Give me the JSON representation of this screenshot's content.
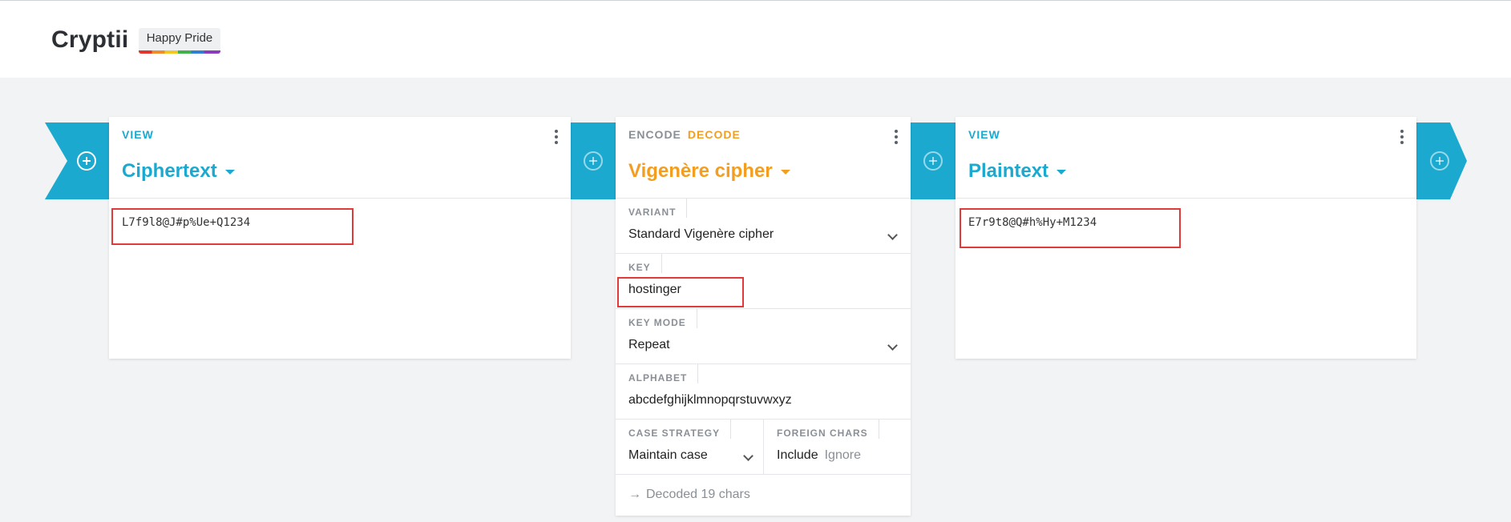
{
  "app": {
    "title": "Cryptii",
    "badge": "Happy Pride"
  },
  "colors": {
    "view_accent": "#1ba9cf",
    "brick_accent": "#f39d21",
    "highlight": "#e03a3a"
  },
  "cards": {
    "left": {
      "kind": "VIEW",
      "title": "Ciphertext",
      "content": "L7f9l8@J#p%Ue+Q1234"
    },
    "middle": {
      "encode_label": "ENCODE",
      "decode_label": "DECODE",
      "title": "Vigenère cipher",
      "settings": {
        "variant": {
          "label": "VARIANT",
          "value": "Standard Vigenère cipher"
        },
        "key": {
          "label": "KEY",
          "value": "hostinger"
        },
        "key_mode": {
          "label": "KEY MODE",
          "value": "Repeat"
        },
        "alphabet": {
          "label": "ALPHABET",
          "value": "abcdefghijklmnopqrstuvwxyz"
        },
        "case_strategy": {
          "label": "CASE STRATEGY",
          "value": "Maintain case"
        },
        "foreign_chars": {
          "label": "FOREIGN CHARS",
          "include": "Include",
          "ignore": "Ignore"
        }
      },
      "status": "Decoded 19 chars"
    },
    "right": {
      "kind": "VIEW",
      "title": "Plaintext",
      "content": "E7r9t8@Q#h%Hy+M1234"
    }
  },
  "icons": [
    "add-icon",
    "more-vert-icon",
    "caret-down-icon",
    "chevron-down-icon",
    "arrow-right-icon"
  ]
}
